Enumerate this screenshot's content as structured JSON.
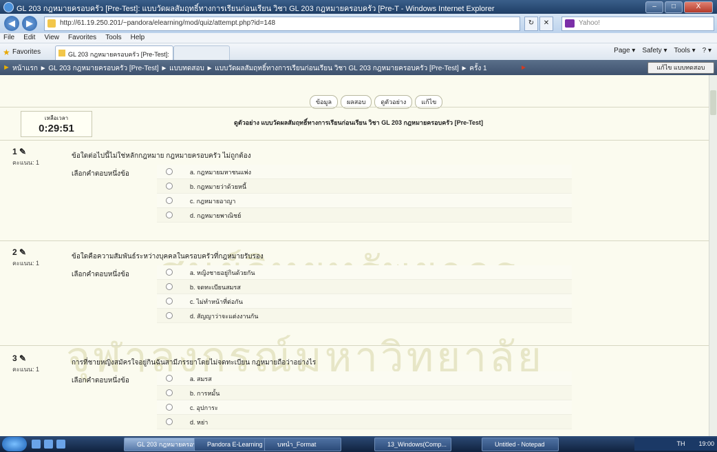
{
  "window": {
    "title": "GL 203 กฎหมายครอบครัว [Pre-Test]: แบบวัดผลสัมฤทธิ์ทางการเรียนก่อนเรียน วิชา GL 203 กฎหมายครอบครัว [Pre-T - Windows Internet Explorer",
    "controls": {
      "minimize": "–",
      "maximize": "□",
      "close": "X"
    }
  },
  "addressbar": {
    "url": "http://61.19.250.201/~pandora/elearning/mod/quiz/attempt.php?id=148",
    "search_placeholder": "Yahoo!",
    "refresh": "↻",
    "stop": "✕",
    "back": "◀",
    "forward": "▶"
  },
  "menu": [
    "File",
    "Edit",
    "View",
    "Favorites",
    "Tools",
    "Help"
  ],
  "favbar": {
    "favorites_label": "Favorites",
    "tab_title": "GL 203 กฎหมายครอบครัว [Pre-Test]: แบบวัดผลสัมฤทธิ์ทาง...",
    "commands": [
      "Page ▾",
      "Safety ▾",
      "Tools ▾",
      "? ▾"
    ]
  },
  "breadcrumb": {
    "text": "หน้าแรก ► GL 203 กฎหมายครอบครัว [Pre-Test] ► แบบทดสอบ ► แบบวัดผลสัมฤทธิ์ทางการเรียนก่อนเรียน วิชา GL 203 กฎหมายครอบครัว [Pre-Test] ► ครั้ง 1",
    "end_button": "แก้ไข แบบทดสอบ"
  },
  "quiz": {
    "tabs": [
      "ข้อมูล",
      "ผลสอบ",
      "ดูตัวอย่าง",
      "แก้ไข"
    ],
    "title": "ดูตัวอย่าง แบบวัดผลสัมฤทธิ์ทางการเรียนก่อนเรียน วิชา GL 203 กฎหมายครอบครัว [Pre-Test]",
    "timer_label": "เหลือเวลา",
    "timer_value": "0:29:51",
    "questions": [
      {
        "number": "1 ✎",
        "score": "คะแนน: 1",
        "text": "ข้อใดต่อไปนี้ไม่ใช่หลักกฎหมาย กฎหมายครอบครัว ไม่ถูกต้อง",
        "prompt": "เลือกคำตอบหนึ่งข้อ",
        "options": [
          "a. กฎหมายมหาชนแพ่ง",
          "b. กฎหมายว่าด้วยหนี้",
          "c. กฎหมายอาญา",
          "d. กฎหมายพาณิชย์"
        ]
      },
      {
        "number": "2 ✎",
        "score": "คะแนน: 1",
        "text": "ข้อใดคือความสัมพันธ์ระหว่างบุคคลในครอบครัวที่กฎหมายรับรอง",
        "prompt": "เลือกคำตอบหนึ่งข้อ",
        "options": [
          "a. หญิงชายอยู่กินด้วยกัน",
          "b. จดทะเบียนสมรส",
          "c. ไม่ทำหน้าที่ต่อกัน",
          "d. สัญญาว่าจะแต่งงานกัน"
        ]
      },
      {
        "number": "3 ✎",
        "score": "คะแนน: 1",
        "text": "การที่ชายหญิงสมัครใจอยู่กินฉันสามีภรรยาโดยไม่จดทะเบียน กฎหมายถือว่าอย่างไร",
        "prompt": "เลือกคำตอบหนึ่งข้อ",
        "options": [
          "a. สมรส",
          "b. การหมั้น",
          "c. อุปการะ",
          "d. หย่า"
        ]
      }
    ]
  },
  "watermark": {
    "line1": "ศูนย์วิทยทรัพยากร",
    "line2": "จุฬาลงกรณ์มหาวิทยาลัย"
  },
  "taskbar": {
    "buttons": [
      "GL 203 กฎหมายครอบครัว...",
      "Pandora E-Learning - ...",
      "บทนำ_Format",
      "13_Windows(Comp...",
      "Untitled - Notepad"
    ],
    "clock": "19:00",
    "lang": "TH"
  }
}
